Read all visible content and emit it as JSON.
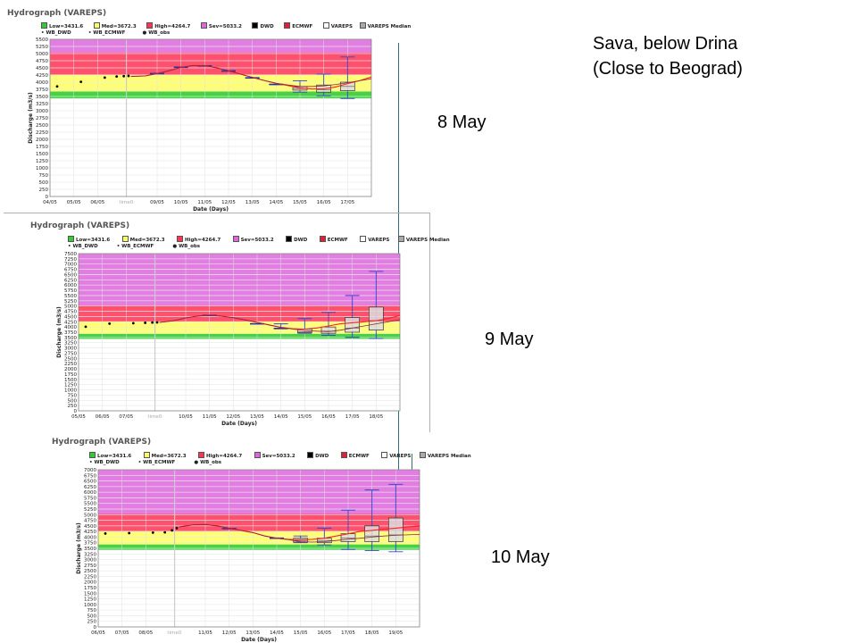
{
  "texts": {
    "location_line1": "Sava, below Drina",
    "location_line2": "(Close to Beograd)",
    "date_1": "8 May",
    "date_2": "9 May",
    "date_3": "10 May"
  },
  "legend": {
    "low": "Low=3431.6",
    "med": "Med=3672.3",
    "high": "High=4264.7",
    "sev": "Sev=5033.2",
    "dwd": "DWD",
    "ecmwf": "ECMWF",
    "vareps": "VAREPS",
    "vareps_median": "VAREPS Median",
    "wb_dwd": "WB_DWD",
    "wb_ecmwf": "WB_ECMWF",
    "wb_obs": "WB_obs"
  },
  "colors": {
    "low": "#33cc33",
    "med": "#ffff66",
    "high": "#ff3355",
    "sev": "#dd66dd",
    "dwd": "#000000",
    "ecmwf": "#e0203a",
    "vareps": "#dddddd",
    "vareps_median": "#aaaaaa",
    "box_whisker": "#3344cc",
    "forecast_line": "#ff2222",
    "obs_point": "#000000"
  },
  "chart_data": [
    {
      "type": "line",
      "title": "Hydrograph (VAREPS)",
      "xlabel": "Date (Days)",
      "ylabel": "Discharge (m3/s)",
      "ylim": [
        0,
        5500
      ],
      "yticks": [
        0,
        250,
        500,
        750,
        1000,
        1250,
        1500,
        1750,
        2000,
        2250,
        2500,
        2750,
        3000,
        3250,
        3500,
        3750,
        4000,
        4250,
        4500,
        4750,
        5000,
        5250,
        5500
      ],
      "xlim": [
        0,
        13.5
      ],
      "xticks": [
        {
          "x": 0,
          "label": "04/05"
        },
        {
          "x": 1,
          "label": "05/05"
        },
        {
          "x": 2,
          "label": "06/05"
        },
        {
          "x": 3.2,
          "label": "time0"
        },
        {
          "x": 4.5,
          "label": "09/05"
        },
        {
          "x": 5.5,
          "label": "10/05"
        },
        {
          "x": 6.5,
          "label": "11/05"
        },
        {
          "x": 7.5,
          "label": "12/05"
        },
        {
          "x": 8.5,
          "label": "13/05"
        },
        {
          "x": 9.5,
          "label": "14/05"
        },
        {
          "x": 10.5,
          "label": "15/05"
        },
        {
          "x": 11.5,
          "label": "16/05"
        },
        {
          "x": 12.5,
          "label": "17/05"
        }
      ],
      "time0": 3.4,
      "thresholds": {
        "low": 3431.6,
        "med": 3672.3,
        "high": 4264.7,
        "sev": 5033.2
      },
      "obs": {
        "x": [
          0.3,
          1.3,
          2.3,
          2.8,
          3.1,
          3.3
        ],
        "y": [
          3850,
          4010,
          4160,
          4200,
          4210,
          4220
        ]
      },
      "series": [
        {
          "name": "ECMWF",
          "x": [
            3.4,
            4.0,
            4.5,
            5.0,
            5.5,
            6.0,
            6.5,
            7.0,
            7.5,
            8.0,
            8.5,
            9.0,
            9.5,
            10.0,
            10.5,
            11.0,
            11.5,
            12.0,
            12.5,
            13.0,
            13.5
          ],
          "y": [
            4200,
            4220,
            4300,
            4400,
            4520,
            4580,
            4580,
            4500,
            4400,
            4280,
            4170,
            4060,
            3960,
            3880,
            3800,
            3760,
            3770,
            3830,
            3950,
            4050,
            4180
          ]
        },
        {
          "name": "DWD",
          "x": [
            3.4,
            4.0,
            4.5,
            5.0,
            5.5,
            6.0,
            6.5,
            7.0,
            7.5,
            8.0,
            8.5,
            9.0,
            9.5,
            10.0,
            10.5,
            11.0,
            11.5,
            12.0,
            12.5,
            13.0,
            13.5
          ],
          "y": [
            4200,
            4220,
            4300,
            4400,
            4520,
            4580,
            4580,
            4500,
            4400,
            4280,
            4170,
            4060,
            3960,
            3900,
            3850,
            3850,
            3870,
            3920,
            3980,
            4050,
            4120
          ]
        }
      ],
      "boxes": [
        {
          "x": 4.5,
          "min": 4300,
          "q1": 4300,
          "med": 4300,
          "q3": 4300,
          "max": 4300
        },
        {
          "x": 5.5,
          "min": 4520,
          "q1": 4520,
          "med": 4520,
          "q3": 4520,
          "max": 4520
        },
        {
          "x": 6.5,
          "min": 4570,
          "q1": 4570,
          "med": 4570,
          "q3": 4570,
          "max": 4570
        },
        {
          "x": 7.5,
          "min": 4390,
          "q1": 4390,
          "med": 4390,
          "q3": 4390,
          "max": 4390
        },
        {
          "x": 8.5,
          "min": 4150,
          "q1": 4150,
          "med": 4150,
          "q3": 4150,
          "max": 4150
        },
        {
          "x": 9.5,
          "min": 3920,
          "q1": 3920,
          "med": 3920,
          "q3": 3920,
          "max": 3920
        },
        {
          "x": 10.5,
          "min": 3650,
          "q1": 3720,
          "med": 3780,
          "q3": 3850,
          "max": 4050
        },
        {
          "x": 11.5,
          "min": 3520,
          "q1": 3650,
          "med": 3740,
          "q3": 3900,
          "max": 4280
        },
        {
          "x": 12.5,
          "min": 3430,
          "q1": 3700,
          "med": 3850,
          "q3": 4000,
          "max": 4880
        }
      ]
    },
    {
      "type": "line",
      "title": "Hydrograph (VAREPS)",
      "xlabel": "Date (Days)",
      "ylabel": "Discharge (m3/s)",
      "ylim": [
        0,
        7500
      ],
      "yticks": [
        0,
        250,
        500,
        750,
        1000,
        1250,
        1500,
        1750,
        2000,
        2250,
        2500,
        2750,
        3000,
        3250,
        3500,
        3750,
        4000,
        4250,
        4500,
        4750,
        5000,
        5250,
        5500,
        5750,
        6000,
        6250,
        6500,
        6750,
        7000,
        7250,
        7500
      ],
      "xlim": [
        0,
        13.5
      ],
      "xticks": [
        {
          "x": 0,
          "label": "05/05"
        },
        {
          "x": 1,
          "label": "06/05"
        },
        {
          "x": 2,
          "label": "07/05"
        },
        {
          "x": 3.2,
          "label": "time0"
        },
        {
          "x": 4.5,
          "label": "10/05"
        },
        {
          "x": 5.5,
          "label": "11/05"
        },
        {
          "x": 6.5,
          "label": "12/05"
        },
        {
          "x": 7.5,
          "label": "13/05"
        },
        {
          "x": 8.5,
          "label": "14/05"
        },
        {
          "x": 9.5,
          "label": "15/05"
        },
        {
          "x": 10.5,
          "label": "16/05"
        },
        {
          "x": 11.5,
          "label": "17/05"
        },
        {
          "x": 12.5,
          "label": "18/05"
        }
      ],
      "time0": 3.4,
      "thresholds": {
        "low": 3431.6,
        "med": 3672.3,
        "high": 4264.7,
        "sev": 5033.2
      },
      "obs": {
        "x": [
          0.3,
          1.3,
          2.3,
          2.8,
          3.1,
          3.3
        ],
        "y": [
          4010,
          4160,
          4180,
          4200,
          4210,
          4220
        ]
      },
      "series": [
        {
          "name": "ECMWF",
          "x": [
            3.4,
            4.0,
            4.5,
            5.0,
            5.5,
            6.0,
            6.5,
            7.0,
            7.5,
            8.0,
            8.5,
            9.0,
            9.5,
            10.0,
            10.5,
            11.0,
            11.5,
            12.0,
            12.5,
            13.0,
            13.5
          ],
          "y": [
            4220,
            4300,
            4430,
            4520,
            4560,
            4520,
            4440,
            4340,
            4220,
            4100,
            3980,
            3920,
            3900,
            3950,
            4050,
            4150,
            4200,
            4250,
            4300,
            4400,
            4550
          ]
        },
        {
          "name": "DWD",
          "x": [
            3.4,
            4.0,
            4.5,
            5.0,
            5.5,
            6.0,
            6.5,
            7.0,
            7.5,
            8.0,
            8.5,
            9.0,
            9.5,
            10.0,
            10.5,
            11.0,
            11.5,
            12.0,
            12.5,
            13.0,
            13.5
          ],
          "y": [
            4220,
            4300,
            4430,
            4520,
            4560,
            4520,
            4440,
            4340,
            4220,
            4100,
            3980,
            3900,
            3830,
            3800,
            3780,
            3850,
            3950,
            4050,
            4150,
            4250,
            4350
          ]
        }
      ],
      "boxes": [
        {
          "x": 5.5,
          "min": 4550,
          "q1": 4550,
          "med": 4550,
          "q3": 4550,
          "max": 4550
        },
        {
          "x": 7.5,
          "min": 4150,
          "q1": 4150,
          "med": 4150,
          "q3": 4150,
          "max": 4150
        },
        {
          "x": 8.5,
          "min": 3930,
          "q1": 3930,
          "med": 3930,
          "q3": 3930,
          "max": 4150
        },
        {
          "x": 9.5,
          "min": 3700,
          "q1": 3730,
          "med": 3780,
          "q3": 3900,
          "max": 4400
        },
        {
          "x": 10.5,
          "min": 3600,
          "q1": 3700,
          "med": 3800,
          "q3": 4000,
          "max": 4700
        },
        {
          "x": 11.5,
          "min": 3500,
          "q1": 3750,
          "med": 3950,
          "q3": 4450,
          "max": 5500
        },
        {
          "x": 12.5,
          "min": 3450,
          "q1": 3850,
          "med": 4300,
          "q3": 4950,
          "max": 6650
        }
      ]
    },
    {
      "type": "line",
      "title": "Hydrograph (VAREPS)",
      "xlabel": "Date (Days)",
      "ylabel": "Discharge (m3/s)",
      "ylim": [
        0,
        7000
      ],
      "yticks": [
        0,
        250,
        500,
        750,
        1000,
        1250,
        1500,
        1750,
        2000,
        2250,
        2500,
        2750,
        3000,
        3250,
        3500,
        3750,
        4000,
        4250,
        4500,
        4750,
        5000,
        5250,
        5500,
        5750,
        6000,
        6250,
        6500,
        6750,
        7000
      ],
      "xlim": [
        0,
        13.5
      ],
      "xticks": [
        {
          "x": 0,
          "label": "06/05"
        },
        {
          "x": 1,
          "label": "07/05"
        },
        {
          "x": 2,
          "label": "08/05"
        },
        {
          "x": 3.2,
          "label": "time0"
        },
        {
          "x": 4.5,
          "label": "11/05"
        },
        {
          "x": 5.5,
          "label": "12/05"
        },
        {
          "x": 6.5,
          "label": "13/05"
        },
        {
          "x": 7.5,
          "label": "14/05"
        },
        {
          "x": 8.5,
          "label": "15/05"
        },
        {
          "x": 9.5,
          "label": "16/05"
        },
        {
          "x": 10.5,
          "label": "17/05"
        },
        {
          "x": 11.5,
          "label": "18/05"
        },
        {
          "x": 12.5,
          "label": "19/05"
        }
      ],
      "time0": 3.4,
      "thresholds": {
        "low": 3431.6,
        "med": 3672.3,
        "high": 4264.7,
        "sev": 5033.2
      },
      "obs": {
        "x": [
          0.3,
          1.3,
          2.3,
          2.8,
          3.1,
          3.3
        ],
        "y": [
          4160,
          4180,
          4200,
          4210,
          4300,
          4400
        ]
      },
      "series": [
        {
          "name": "ECMWF",
          "x": [
            3.4,
            4.0,
            4.5,
            5.0,
            5.5,
            6.0,
            6.5,
            7.0,
            7.5,
            8.0,
            8.5,
            9.0,
            9.5,
            10.0,
            10.5,
            11.0,
            11.5,
            12.0,
            12.5,
            13.0,
            13.5
          ],
          "y": [
            4450,
            4550,
            4560,
            4500,
            4400,
            4300,
            4200,
            4050,
            3950,
            3900,
            3880,
            3900,
            3950,
            4050,
            4150,
            4250,
            4300,
            4350,
            4400,
            4450,
            4500
          ]
        },
        {
          "name": "DWD",
          "x": [
            3.4,
            4.0,
            4.5,
            5.0,
            5.5,
            6.0,
            6.5,
            7.0,
            7.5,
            8.0,
            8.5,
            9.0,
            9.5,
            10.0,
            10.5,
            11.0,
            11.5,
            12.0,
            12.5,
            13.0,
            13.5
          ],
          "y": [
            4450,
            4550,
            4560,
            4500,
            4400,
            4300,
            4200,
            4050,
            3950,
            3880,
            3800,
            3780,
            3800,
            3850,
            3900,
            3950,
            4000,
            4050,
            4080,
            4100,
            4120
          ]
        }
      ],
      "boxes": [
        {
          "x": 5.5,
          "min": 4380,
          "q1": 4380,
          "med": 4380,
          "q3": 4380,
          "max": 4380
        },
        {
          "x": 7.5,
          "min": 3950,
          "q1": 3950,
          "med": 3950,
          "q3": 3950,
          "max": 3950
        },
        {
          "x": 8.5,
          "min": 3750,
          "q1": 3780,
          "med": 3850,
          "q3": 3950,
          "max": 4050
        },
        {
          "x": 9.5,
          "min": 3650,
          "q1": 3750,
          "med": 3850,
          "q3": 3950,
          "max": 4400
        },
        {
          "x": 10.5,
          "min": 3450,
          "q1": 3800,
          "med": 3950,
          "q3": 4150,
          "max": 5200
        },
        {
          "x": 11.5,
          "min": 3400,
          "q1": 3800,
          "med": 4050,
          "q3": 4500,
          "max": 6100
        },
        {
          "x": 12.5,
          "min": 3350,
          "q1": 3800,
          "med": 4100,
          "q3": 4850,
          "max": 6350
        }
      ]
    }
  ]
}
